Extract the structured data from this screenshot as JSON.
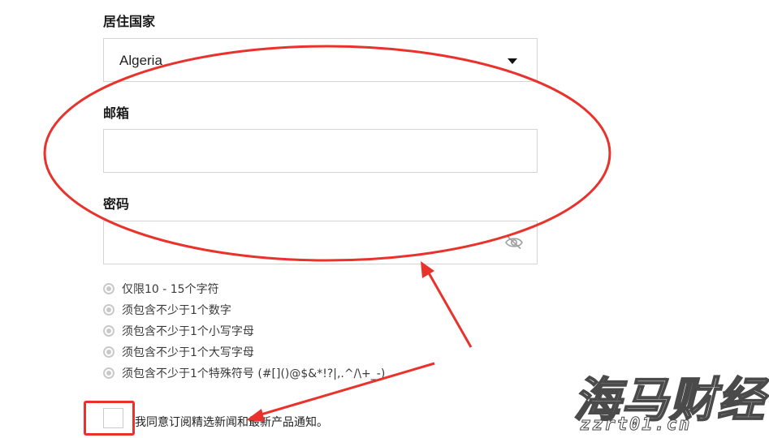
{
  "form": {
    "country": {
      "label": "居住国家",
      "selected": "Algeria"
    },
    "email": {
      "label": "邮箱",
      "value": "",
      "placeholder": ""
    },
    "password": {
      "label": "密码",
      "value": "",
      "placeholder": "",
      "toggle_icon": "eye-slash-icon"
    },
    "password_rules": [
      {
        "text": "仅限10 - 15个字符",
        "icon": "radio-dot-icon"
      },
      {
        "text": "须包含不少于1个数字",
        "icon": "radio-dot-icon"
      },
      {
        "text": "须包含不少于1个小写字母",
        "icon": "radio-dot-icon"
      },
      {
        "text": "须包含不少于1个大写字母",
        "icon": "radio-dot-icon"
      },
      {
        "text": "须包含不少于1个特殊符号 (#[]()@$&*!?|,.^/\\+_-)",
        "icon": "radio-dot-icon"
      }
    ],
    "subscribe": {
      "label": "我同意订阅精选新闻和最新产品通知。",
      "checked": false
    }
  },
  "annotation_color": "#e8322b",
  "watermark": {
    "title": "海马财经",
    "url": "zzrt01.cn"
  }
}
